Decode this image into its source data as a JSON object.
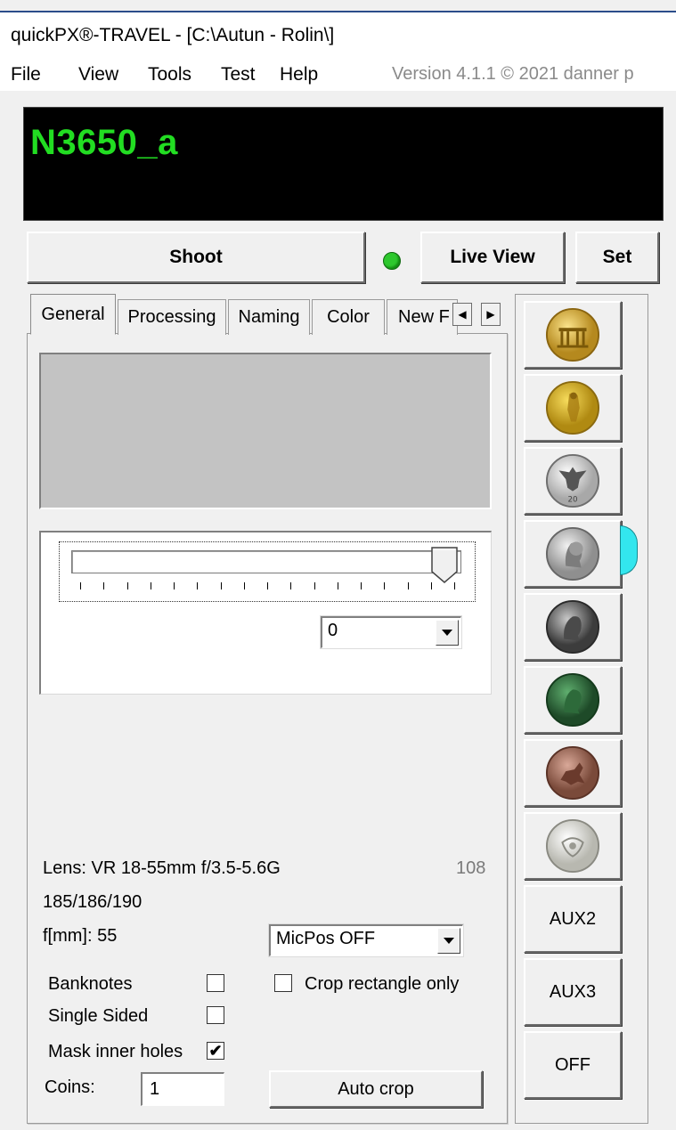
{
  "window": {
    "title": "quickPX®-TRAVEL - [C:\\Autun - Rolin\\]"
  },
  "menu": {
    "items": [
      "File",
      "View",
      "Tools",
      "Test",
      "Help"
    ],
    "version": "Version 4.1.1  © 2021 danner p"
  },
  "display": {
    "text": "N3650_a",
    "text_color": "#22dd22"
  },
  "toolbar": {
    "shoot": "Shoot",
    "live_view": "Live View",
    "set": "Set",
    "led_color": "#2ec82e"
  },
  "tabs": [
    "General",
    "Processing",
    "Naming",
    "Color",
    "New F"
  ],
  "slider": {
    "value_fraction": 1.0,
    "tick_count": 17,
    "select_value": "0"
  },
  "info": {
    "lens": "Lens: VR 18-55mm f/3.5-5.6G",
    "count": "108",
    "ratios": "185/186/190",
    "focal": "f[mm]: 55"
  },
  "options": {
    "micpos": "MicPos OFF",
    "crop_rect_label": "Crop rectangle only",
    "crop_rect_checked": false,
    "banknotes_label": "Banknotes",
    "banknotes_checked": false,
    "single_sided_label": "Single Sided",
    "single_sided_checked": false,
    "mask_label": "Mask inner holes",
    "mask_checked": true,
    "coins_label": "Coins:",
    "coins_value": "1",
    "auto_crop": "Auto crop"
  },
  "coin_buttons": {
    "icons": [
      "coin-brandenburg-gold-icon",
      "coin-gold-ducat-icon",
      "coin-silver-eagle-20-icon",
      "coin-silver-portrait-icon",
      "coin-dark-silver-portrait-icon",
      "coin-green-bronze-portrait-icon",
      "coin-copper-horseman-icon",
      "coin-white-celtic-icon"
    ],
    "selected_index": 3,
    "aux2": "AUX2",
    "aux3": "AUX3",
    "off": "OFF",
    "indicator_color": "#33e6ee"
  }
}
